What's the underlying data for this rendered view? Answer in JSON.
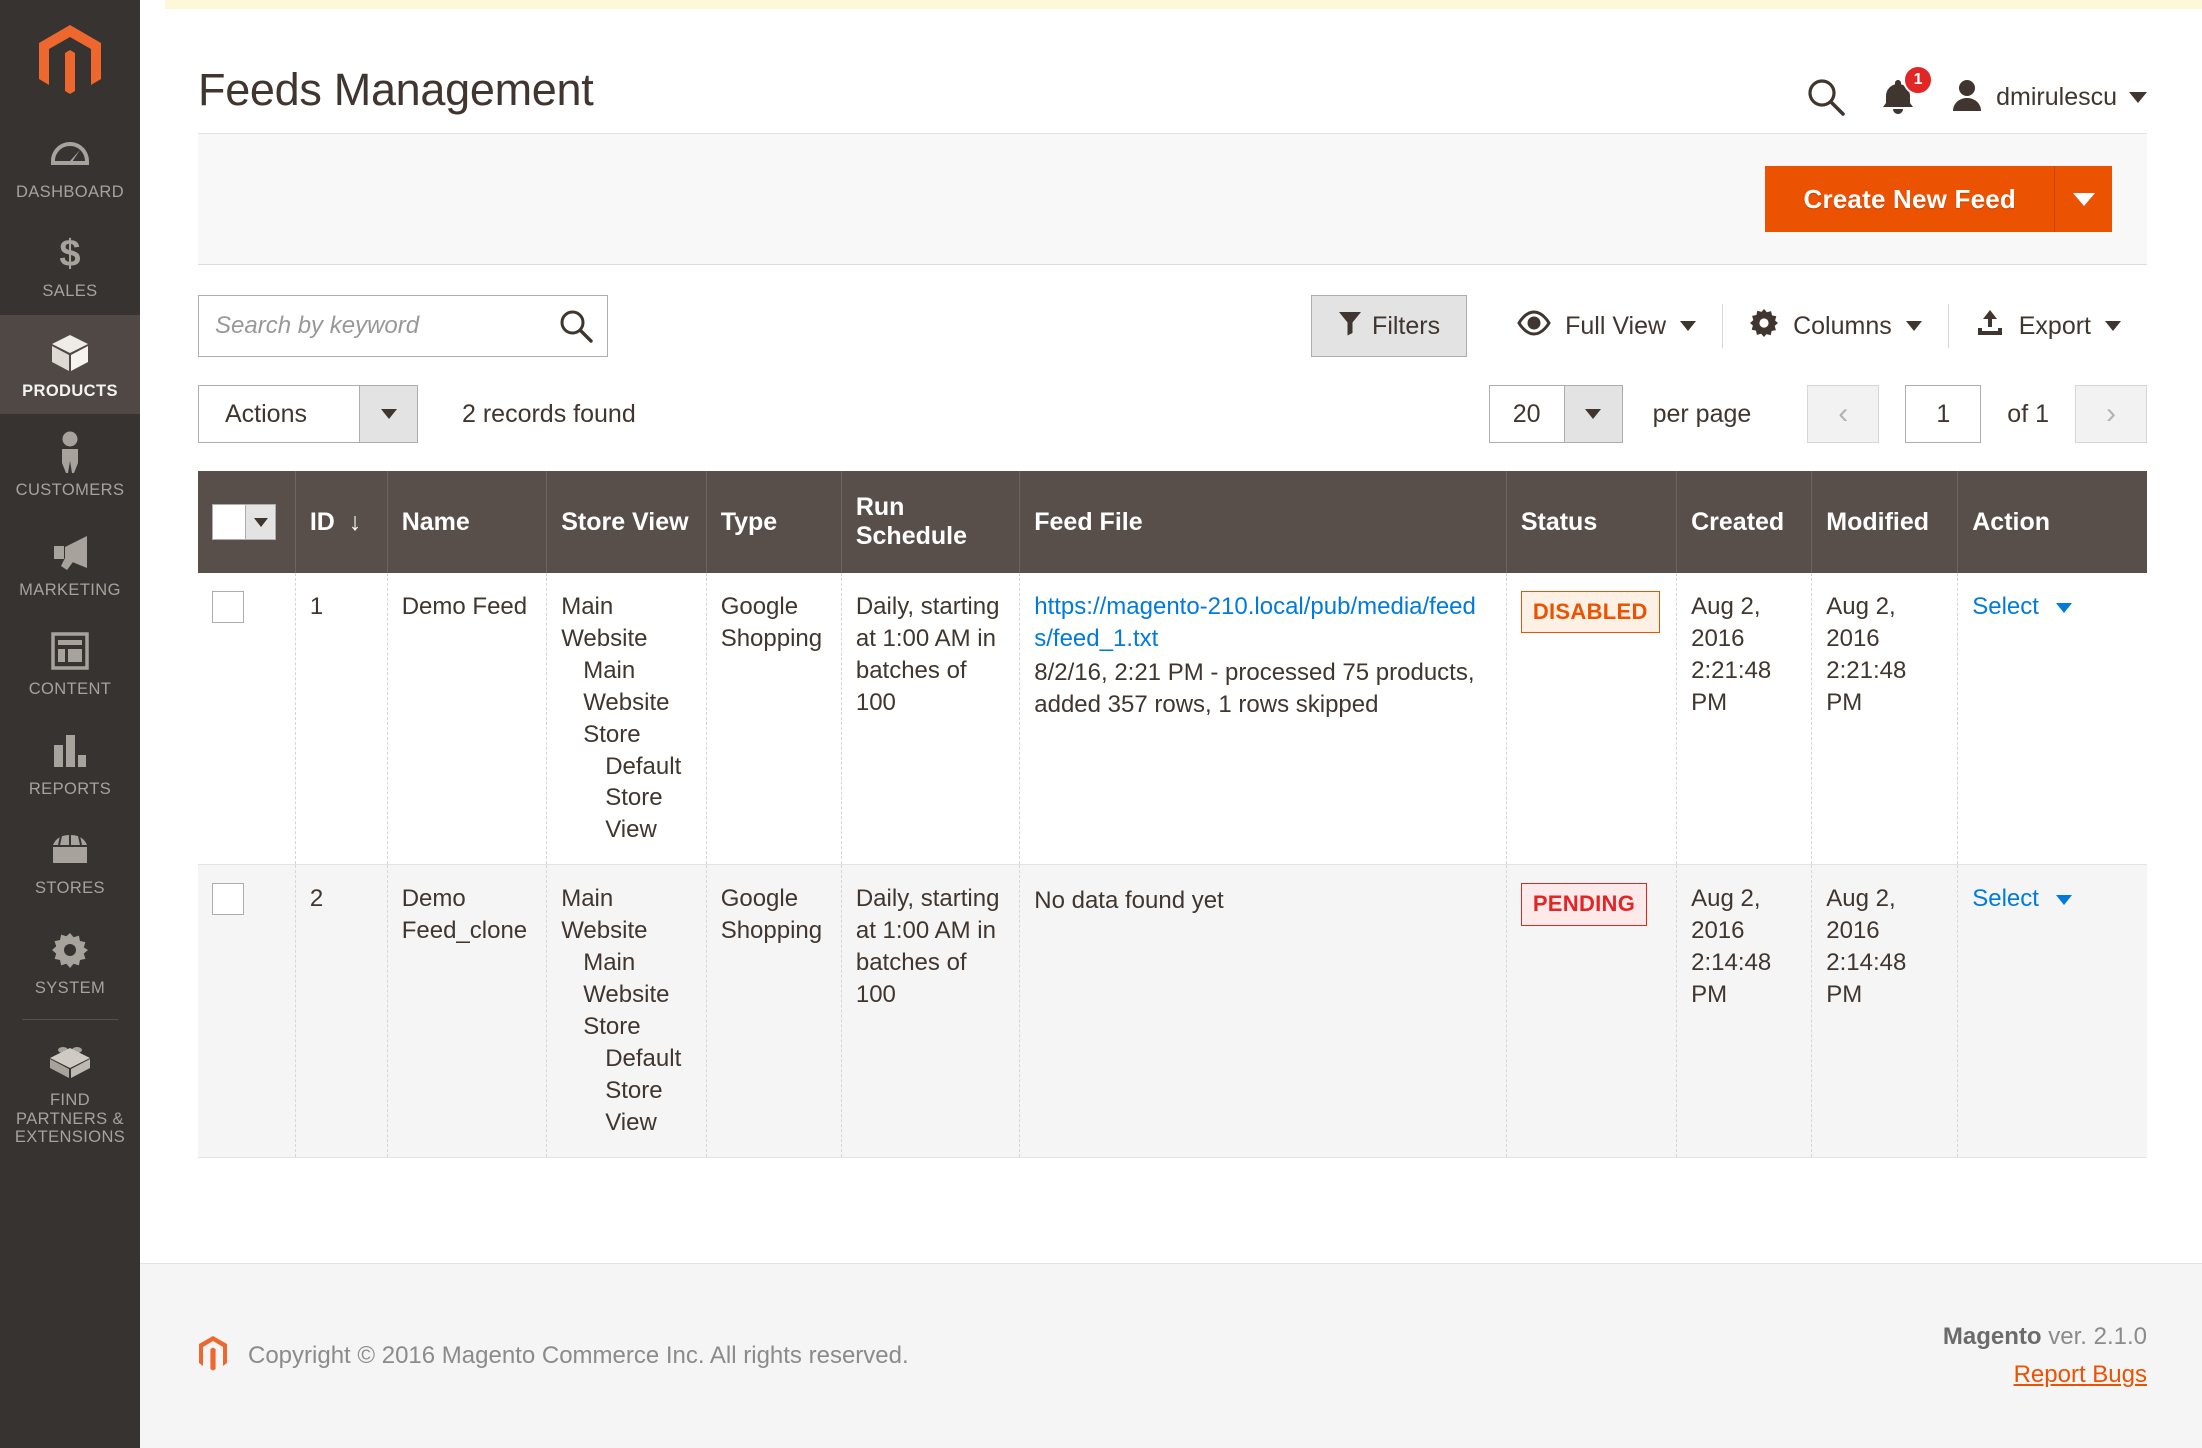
{
  "sidebar": {
    "logo_name": "magento-logo-icon",
    "items": [
      {
        "label": "DASHBOARD",
        "icon": "dashboard-gauge-icon",
        "active": false
      },
      {
        "label": "SALES",
        "icon": "dollar-sign-icon",
        "active": false
      },
      {
        "label": "PRODUCTS",
        "icon": "box-icon",
        "active": true
      },
      {
        "label": "CUSTOMERS",
        "icon": "person-icon",
        "active": false
      },
      {
        "label": "MARKETING",
        "icon": "megaphone-icon",
        "active": false
      },
      {
        "label": "CONTENT",
        "icon": "layout-window-icon",
        "active": false
      },
      {
        "label": "REPORTS",
        "icon": "bar-chart-icon",
        "active": false
      },
      {
        "label": "STORES",
        "icon": "storefront-icon",
        "active": false
      },
      {
        "label": "SYSTEM",
        "icon": "gear-icon",
        "active": false
      },
      {
        "label": "FIND PARTNERS & EXTENSIONS",
        "icon": "lego-brick-icon",
        "active": false
      }
    ]
  },
  "header": {
    "title": "Feeds Management",
    "search_icon": "search-icon",
    "notifications_icon": "bell-icon",
    "notifications_count": "1",
    "user_icon": "avatar-icon",
    "user_name": "dmirulescu",
    "user_caret": "chevron-down-icon"
  },
  "page_actions": {
    "primary_label": "Create New Feed",
    "primary_color": "#eb5202",
    "toggle_icon": "chevron-down-icon"
  },
  "grid_toolbar": {
    "search_placeholder": "Search by keyword",
    "search_value": "",
    "search_icon": "search-icon",
    "filters_label": "Filters",
    "filters_icon": "funnel-icon",
    "view_label": "Full View",
    "view_icon": "eye-icon",
    "columns_label": "Columns",
    "columns_icon": "gear-icon",
    "export_label": "Export",
    "export_icon": "upload-icon"
  },
  "actions_row": {
    "actions_label": "Actions",
    "records_found": "2 records found",
    "per_page_value": "20",
    "per_page_label": "per page",
    "prev_icon": "chevron-left-icon",
    "next_icon": "chevron-right-icon",
    "page_value": "1",
    "of_label": "of 1"
  },
  "table": {
    "columns": [
      {
        "label": "",
        "name": "select-all"
      },
      {
        "label": "ID",
        "name": "id",
        "sort": "↓"
      },
      {
        "label": "Name",
        "name": "name"
      },
      {
        "label": "Store View",
        "name": "store-view"
      },
      {
        "label": "Type",
        "name": "type"
      },
      {
        "label": "Run Schedule",
        "name": "run-schedule"
      },
      {
        "label": "Feed File",
        "name": "feed-file"
      },
      {
        "label": "Status",
        "name": "status"
      },
      {
        "label": "Created",
        "name": "created"
      },
      {
        "label": "Modified",
        "name": "modified"
      },
      {
        "label": "Action",
        "name": "action"
      }
    ],
    "rows": [
      {
        "id": "1",
        "name": "Demo Feed",
        "store_view": {
          "website": "Main Website",
          "store": "Main Website Store",
          "view": "Default Store View"
        },
        "type": "Google Shopping",
        "run_schedule": "Daily, starting at 1:00 AM in batches of 100",
        "feed_file_link": "https://magento-210.local/pub/media/feeds/feed_1.txt",
        "feed_file_note": "8/2/16, 2:21 PM - processed 75 products, added 357 rows, 1 rows skipped",
        "status": "DISABLED",
        "status_type": "disabled",
        "created": "Aug 2, 2016 2:21:48 PM",
        "modified": "Aug 2, 2016 2:21:48 PM",
        "action": "Select"
      },
      {
        "id": "2",
        "name": "Demo Feed_clone",
        "store_view": {
          "website": "Main Website",
          "store": "Main Website Store",
          "view": "Default Store View"
        },
        "type": "Google Shopping",
        "run_schedule": "Daily, starting at 1:00 AM in batches of 100",
        "feed_file_link": "",
        "feed_file_note": "No data found yet",
        "status": "PENDING",
        "status_type": "pending",
        "created": "Aug 2, 2016 2:14:48 PM",
        "modified": "Aug 2, 2016 2:14:48 PM",
        "action": "Select"
      }
    ]
  },
  "footer": {
    "copyright": "Copyright © 2016 Magento Commerce Inc. All rights reserved.",
    "version_brand": "Magento",
    "version_text": " ver. 2.1.0",
    "report_bugs": "Report Bugs"
  }
}
